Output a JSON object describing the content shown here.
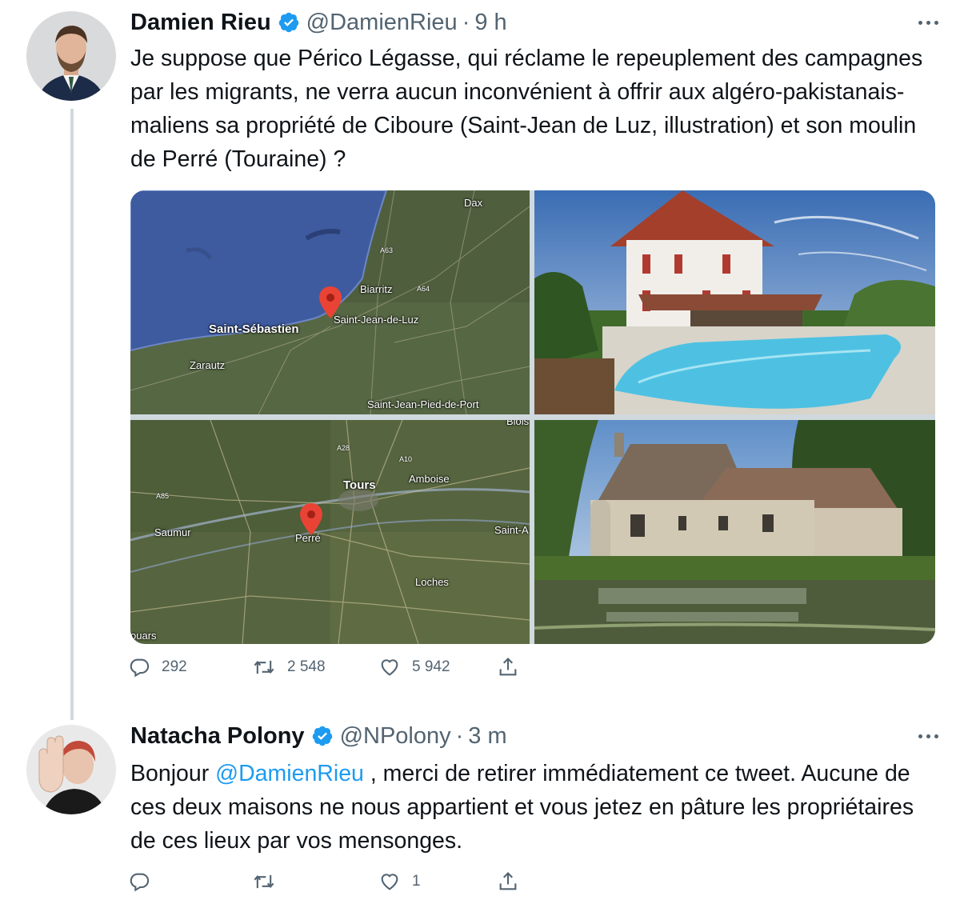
{
  "tweets": [
    {
      "name": "Damien Rieu",
      "handle": "@DamienRieu",
      "separator": "·",
      "time": "9 h",
      "text": "Je suppose que Périco Légasse, qui réclame le repeuplement des campagnes par les migrants, ne verra aucun inconvénient à offrir aux algéro-pakistanais-maliens sa propriété de Ciboure (Saint-Jean de Luz, illustration) et son moulin de Perré (Touraine) ?",
      "media": {
        "map1_labels": [
          "Dax",
          "A63",
          "Biarritz",
          "A64",
          "Saint-Jean-de-Luz",
          "Saint-Sébastien",
          "Zarautz",
          "Saint-Jean-Pied-de-Port"
        ],
        "map2_labels": [
          "Blois",
          "A28",
          "A10",
          "Tours",
          "Amboise",
          "A85",
          "Saumur",
          "Perré",
          "Saint-A",
          "Loches",
          "ouars"
        ]
      },
      "actions": {
        "reply": "292",
        "retweet": "2 548",
        "like": "5 942"
      }
    },
    {
      "name": "Natacha Polony",
      "handle": "@NPolony",
      "separator": "·",
      "time": "3 m",
      "text_pre": "Bonjour ",
      "mention": "@DamienRieu",
      "text_post": " , merci de retirer immédiatement ce tweet. Aucune de ces deux maisons ne nous appartient et vous jetez en pâture les propriétaires de ces lieux par vos mensonges.",
      "actions": {
        "reply": "",
        "retweet": "",
        "like": "1"
      }
    }
  ],
  "colors": {
    "accent": "#1d9bf0",
    "secondary_text": "#536471",
    "thread_line": "#cfd9de"
  }
}
